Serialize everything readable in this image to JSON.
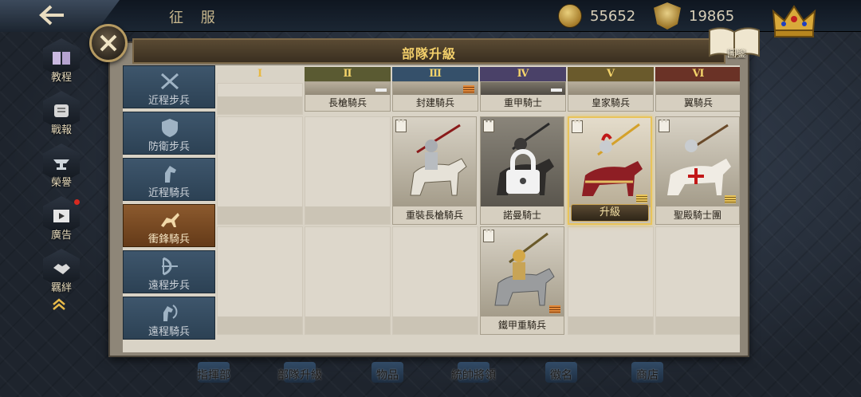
{
  "topbar": {
    "title": "征 服",
    "gold": "55652",
    "honor": "19865"
  },
  "side_menu": [
    {
      "label": "教程",
      "icon": "book-icon"
    },
    {
      "label": "戰報",
      "icon": "scroll-icon"
    },
    {
      "label": "榮譽",
      "icon": "anvil-icon"
    },
    {
      "label": "廣告",
      "icon": "film-icon"
    },
    {
      "label": "羈絆",
      "icon": "handshake-icon"
    }
  ],
  "panel": {
    "title": "部隊升級",
    "codex_label": "圖鑒"
  },
  "tiers": [
    "Ⅰ",
    "Ⅱ",
    "Ⅲ",
    "Ⅳ",
    "Ⅴ",
    "Ⅵ"
  ],
  "categories": [
    {
      "label": "近程步兵",
      "icon": "crossed-swords-icon"
    },
    {
      "label": "防衛步兵",
      "icon": "shield-icon"
    },
    {
      "label": "近程騎兵",
      "icon": "horse-head-icon"
    },
    {
      "label": "衝鋒騎兵",
      "icon": "charging-horse-icon",
      "active": true
    },
    {
      "label": "遠程步兵",
      "icon": "bow-icon"
    },
    {
      "label": "遠程騎兵",
      "icon": "mounted-archer-icon"
    }
  ],
  "top_row_units": [
    "長槍騎兵",
    "封建騎兵",
    "重甲騎士",
    "皇家騎兵",
    "翼騎兵"
  ],
  "units": {
    "heavy_lancer": "重裝長槍騎兵",
    "norman_knight": "諾曼騎士",
    "upgrade_button": "升級",
    "holy_knights": "聖殿騎士團",
    "iron_cavalry": "鐵甲重騎兵"
  },
  "bottom_nav": [
    "指揮部",
    "部隊升級",
    "物品",
    "統帥將領",
    "徽名",
    "商店"
  ],
  "colors": {
    "accent_gold": "#f1ce6a",
    "category_blue": "#3e566c",
    "category_active": "#8c5a2e"
  }
}
